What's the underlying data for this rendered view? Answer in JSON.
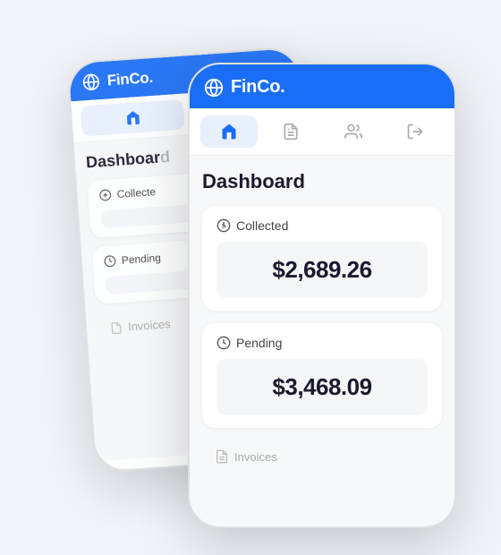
{
  "app": {
    "name": "FinCo.",
    "header_icon": "🌐"
  },
  "nav": {
    "items": [
      {
        "id": "home",
        "label": "Home",
        "active": true
      },
      {
        "id": "documents",
        "label": "Documents",
        "active": false
      },
      {
        "id": "users",
        "label": "Users",
        "active": false
      },
      {
        "id": "logout",
        "label": "Logout",
        "active": false
      }
    ]
  },
  "dashboard": {
    "title": "Dashboard",
    "cards": [
      {
        "id": "collected",
        "label": "Collected",
        "value": "$2,689.26",
        "icon": "dollar"
      },
      {
        "id": "pending",
        "label": "Pending",
        "value": "$3,468.09",
        "icon": "clock"
      }
    ],
    "bottom_nav": {
      "label": "Invoices",
      "icon": "document"
    }
  }
}
